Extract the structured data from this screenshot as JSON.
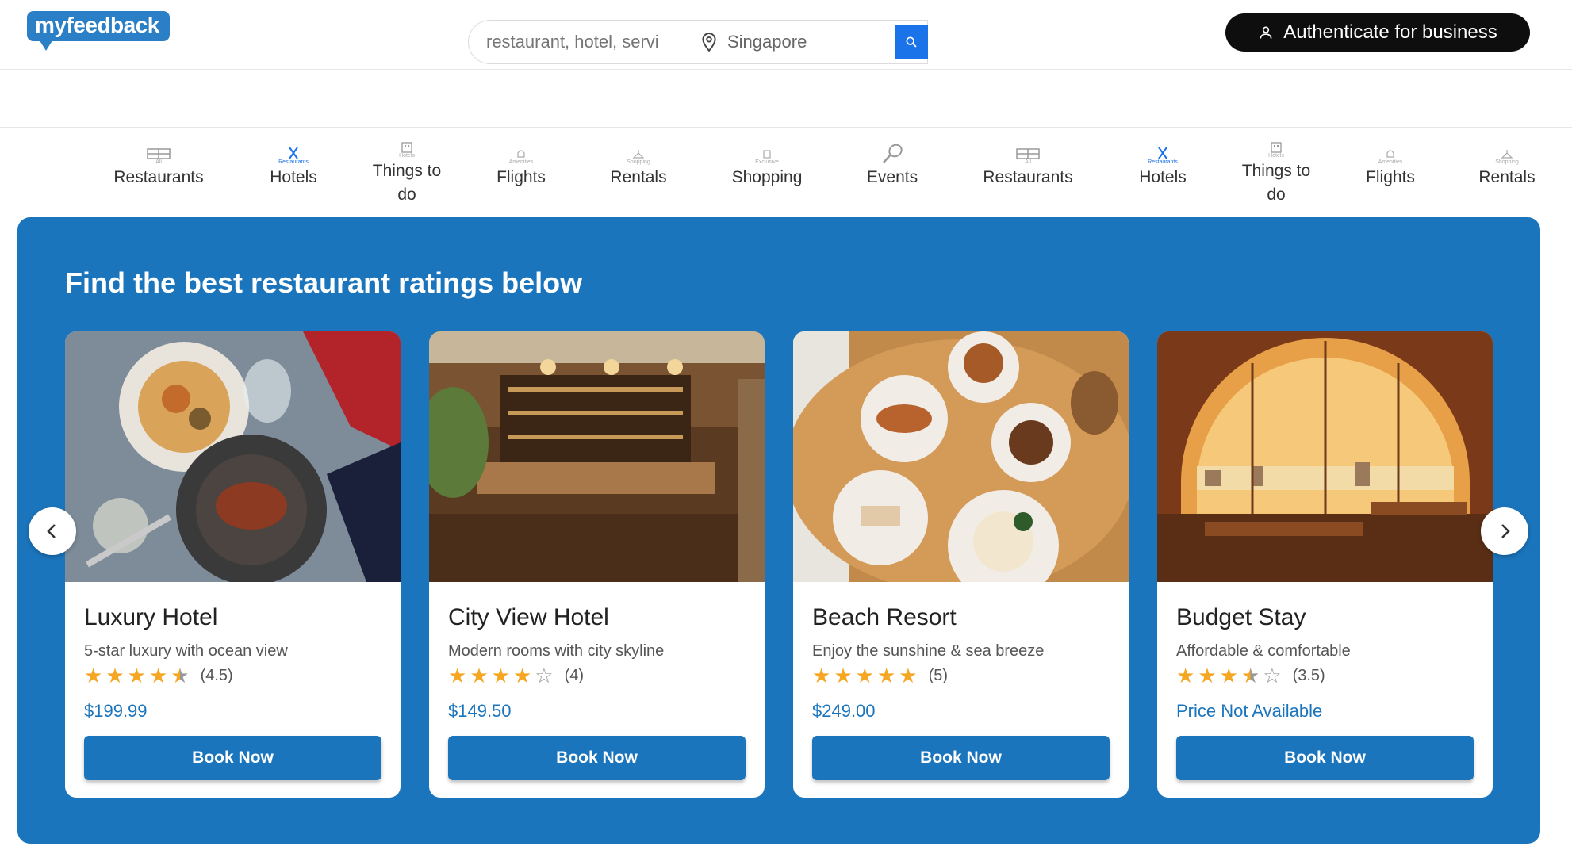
{
  "header": {
    "logo_text": "myfeedback",
    "search_placeholder": "restaurant, hotel, servi",
    "location_value": "Singapore",
    "auth_button_label": "Authenticate for business"
  },
  "categories": [
    {
      "label": "Restaurants",
      "tiny": "All"
    },
    {
      "label": "Hotels",
      "tiny": "Restaurants"
    },
    {
      "label": "Things to do",
      "tiny": "Hotels"
    },
    {
      "label": "Flights",
      "tiny": "Amenities"
    },
    {
      "label": "Rentals",
      "tiny": "Shopping"
    },
    {
      "label": "Shopping",
      "tiny": "Exclusive"
    },
    {
      "label": "Events",
      "tiny": ""
    },
    {
      "label": "Restaurants",
      "tiny": "All"
    },
    {
      "label": "Hotels",
      "tiny": "Restaurants"
    },
    {
      "label": "Things to do",
      "tiny": "Hotels"
    },
    {
      "label": "Flights",
      "tiny": "Amenities"
    },
    {
      "label": "Rentals",
      "tiny": "Shopping"
    }
  ],
  "main": {
    "title": "Find the best restaurant ratings below",
    "cards": [
      {
        "name": "Luxury Hotel",
        "description": "5-star luxury with ocean view",
        "rating": 4.5,
        "rating_text": "(4.5)",
        "price": "$199.99",
        "button": "Book Now",
        "image": "plated-dishes-photo"
      },
      {
        "name": "City View Hotel",
        "description": "Modern rooms with city skyline",
        "rating": 4,
        "rating_text": "(4)",
        "price": "$149.50",
        "button": "Book Now",
        "image": "restaurant-interior-photo"
      },
      {
        "name": "Beach Resort",
        "description": "Enjoy the sunshine & sea breeze",
        "rating": 5,
        "rating_text": "(5)",
        "price": "$249.00",
        "button": "Book Now",
        "image": "table-food-photo"
      },
      {
        "name": "Budget Stay",
        "description": "Affordable & comfortable",
        "rating": 3.5,
        "rating_text": "(3.5)",
        "price": "Price Not Available",
        "button": "Book Now",
        "image": "window-dining-photo"
      }
    ]
  },
  "colors": {
    "brand_blue": "#1b75bc",
    "search_blue": "#1a73e8",
    "star": "#f5a623",
    "auth_button": "#0e0e0e"
  },
  "icons": {
    "prev": "chevron-left-icon",
    "next": "chevron-right-icon",
    "search": "search-icon",
    "location": "map-pin-icon",
    "user": "user-icon"
  }
}
